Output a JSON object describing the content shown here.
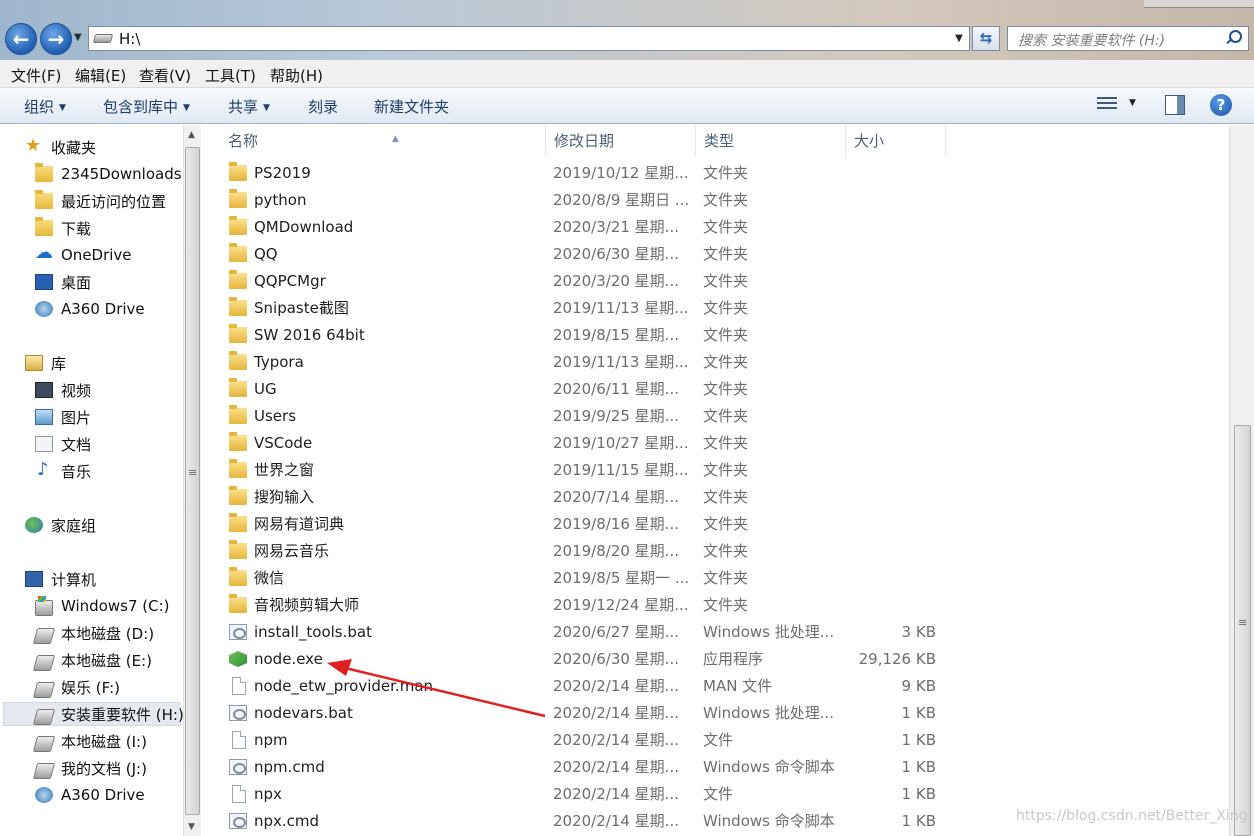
{
  "address": {
    "path": "H:\\"
  },
  "search": {
    "placeholder": "搜索 安装重要软件 (H:)"
  },
  "menu": [
    "文件(F)",
    "编辑(E)",
    "查看(V)",
    "工具(T)",
    "帮助(H)"
  ],
  "toolbar": {
    "organize": "组织",
    "include_library": "包含到库中",
    "share": "共享",
    "burn": "刻录",
    "new_folder": "新建文件夹"
  },
  "nav": {
    "favorites": {
      "label": "收藏夹",
      "items": [
        "2345Downloads",
        "最近访问的位置",
        "下载",
        "OneDrive",
        "桌面",
        "A360 Drive"
      ]
    },
    "libraries": {
      "label": "库",
      "items": [
        "视频",
        "图片",
        "文档",
        "音乐"
      ]
    },
    "homegroup": {
      "label": "家庭组"
    },
    "computer": {
      "label": "计算机",
      "items": [
        "Windows7 (C:)",
        "本地磁盘 (D:)",
        "本地磁盘 (E:)",
        "娱乐 (F:)",
        "安装重要软件 (H:)",
        "本地磁盘 (I:)",
        "我的文档 (J:)",
        "A360 Drive"
      ]
    }
  },
  "columns": {
    "name": "名称",
    "date": "修改日期",
    "type": "类型",
    "size": "大小"
  },
  "files": [
    {
      "name": "PS2019",
      "date": "2019/10/12 星期...",
      "type": "文件夹",
      "size": "",
      "icon": "folder"
    },
    {
      "name": "python",
      "date": "2020/8/9 星期日 ...",
      "type": "文件夹",
      "size": "",
      "icon": "folder"
    },
    {
      "name": "QMDownload",
      "date": "2020/3/21 星期...",
      "type": "文件夹",
      "size": "",
      "icon": "folder"
    },
    {
      "name": "QQ",
      "date": "2020/6/30 星期...",
      "type": "文件夹",
      "size": "",
      "icon": "folder"
    },
    {
      "name": "QQPCMgr",
      "date": "2020/3/20 星期...",
      "type": "文件夹",
      "size": "",
      "icon": "folder"
    },
    {
      "name": "Snipaste截图",
      "date": "2019/11/13 星期...",
      "type": "文件夹",
      "size": "",
      "icon": "folder"
    },
    {
      "name": "SW 2016 64bit",
      "date": "2019/8/15 星期...",
      "type": "文件夹",
      "size": "",
      "icon": "folder"
    },
    {
      "name": "Typora",
      "date": "2019/11/13 星期...",
      "type": "文件夹",
      "size": "",
      "icon": "folder"
    },
    {
      "name": "UG",
      "date": "2020/6/11 星期...",
      "type": "文件夹",
      "size": "",
      "icon": "folder"
    },
    {
      "name": "Users",
      "date": "2019/9/25 星期...",
      "type": "文件夹",
      "size": "",
      "icon": "folder"
    },
    {
      "name": "VSCode",
      "date": "2019/10/27 星期...",
      "type": "文件夹",
      "size": "",
      "icon": "folder"
    },
    {
      "name": "世界之窗",
      "date": "2019/11/15 星期...",
      "type": "文件夹",
      "size": "",
      "icon": "folder"
    },
    {
      "name": "搜狗输入",
      "date": "2020/7/14 星期...",
      "type": "文件夹",
      "size": "",
      "icon": "folder"
    },
    {
      "name": "网易有道词典",
      "date": "2019/8/16 星期...",
      "type": "文件夹",
      "size": "",
      "icon": "folder"
    },
    {
      "name": "网易云音乐",
      "date": "2019/8/20 星期...",
      "type": "文件夹",
      "size": "",
      "icon": "folder"
    },
    {
      "name": "微信",
      "date": "2019/8/5 星期一 ...",
      "type": "文件夹",
      "size": "",
      "icon": "folder"
    },
    {
      "name": "音视频剪辑大师",
      "date": "2019/12/24 星期...",
      "type": "文件夹",
      "size": "",
      "icon": "folder"
    },
    {
      "name": "install_tools.bat",
      "date": "2020/6/27 星期...",
      "type": "Windows 批处理...",
      "size": "3 KB",
      "icon": "bat"
    },
    {
      "name": "node.exe",
      "date": "2020/6/30 星期...",
      "type": "应用程序",
      "size": "29,126 KB",
      "icon": "exe"
    },
    {
      "name": "node_etw_provider.man",
      "date": "2020/2/14 星期...",
      "type": "MAN 文件",
      "size": "9 KB",
      "icon": "file"
    },
    {
      "name": "nodevars.bat",
      "date": "2020/2/14 星期...",
      "type": "Windows 批处理...",
      "size": "1 KB",
      "icon": "bat"
    },
    {
      "name": "npm",
      "date": "2020/2/14 星期...",
      "type": "文件",
      "size": "1 KB",
      "icon": "file"
    },
    {
      "name": "npm.cmd",
      "date": "2020/2/14 星期...",
      "type": "Windows 命令脚本",
      "size": "1 KB",
      "icon": "bat"
    },
    {
      "name": "npx",
      "date": "2020/2/14 星期...",
      "type": "文件",
      "size": "1 KB",
      "icon": "file"
    },
    {
      "name": "npx.cmd",
      "date": "2020/2/14 星期...",
      "type": "Windows 命令脚本",
      "size": "1 KB",
      "icon": "bat"
    }
  ],
  "watermark": "https://blog.csdn.net/Better_Xing",
  "colors": {
    "annotation_arrow": "#e02020",
    "command_text": "#1e3c66"
  }
}
